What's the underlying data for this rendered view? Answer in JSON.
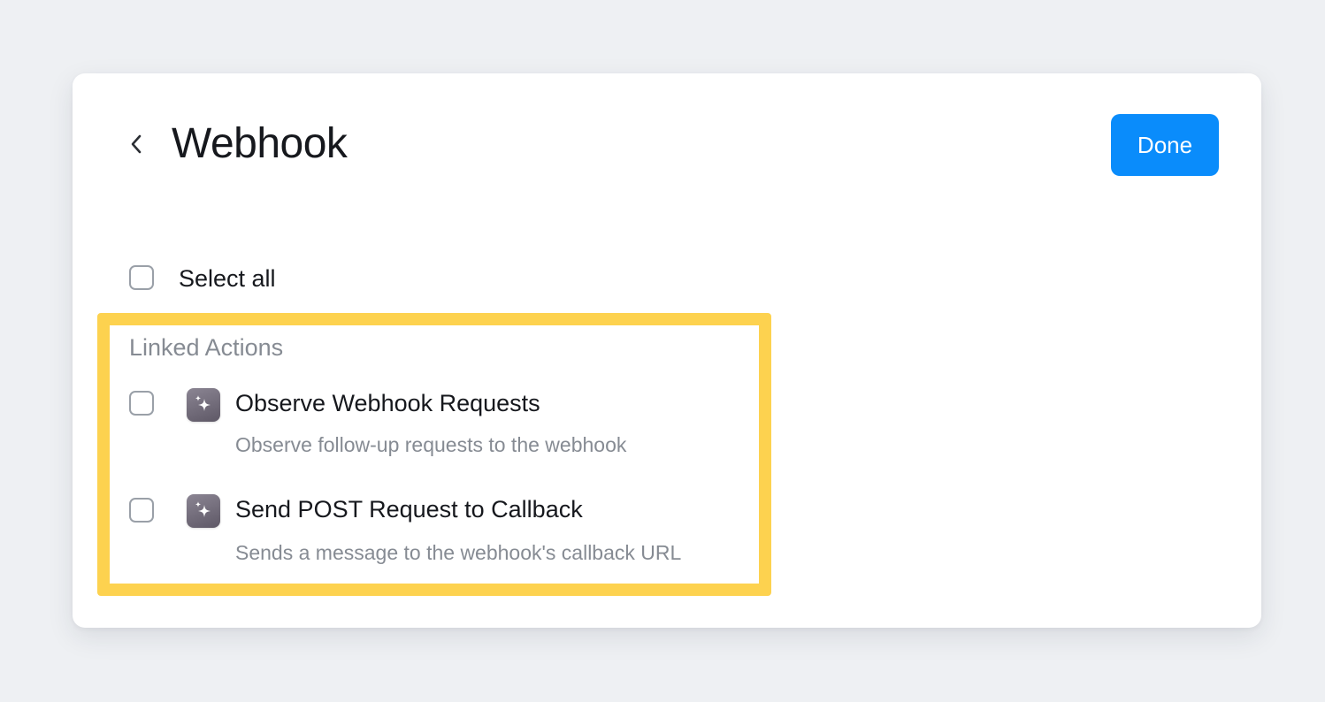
{
  "header": {
    "title": "Webhook",
    "done_label": "Done"
  },
  "select_all": {
    "label": "Select all",
    "checked": false
  },
  "linked_actions": {
    "section_label": "Linked Actions",
    "items": [
      {
        "title": "Observe Webhook Requests",
        "description": "Observe follow-up requests to the webhook",
        "icon": "sparkle-icon",
        "checked": false
      },
      {
        "title": "Send POST Request to Callback",
        "description": "Sends a message to the webhook's callback URL",
        "icon": "sparkle-icon",
        "checked": false
      }
    ]
  },
  "colors": {
    "accent": "#0a8cfb",
    "highlight": "#fdd24f",
    "background": "#eef0f3"
  }
}
